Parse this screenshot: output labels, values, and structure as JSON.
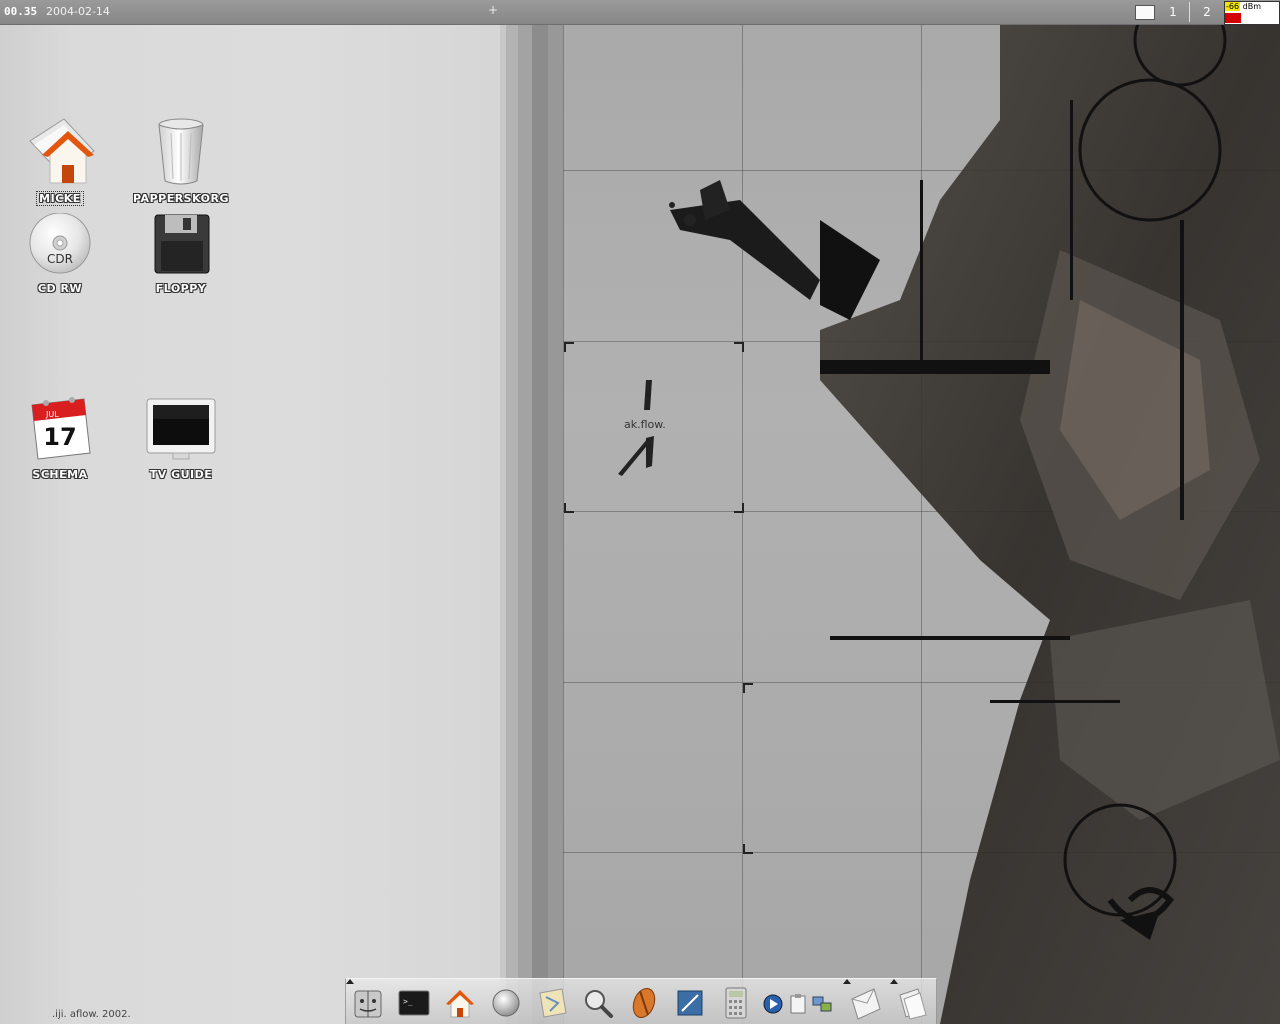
{
  "topbar": {
    "clock": "00.35",
    "date": "2004-02-14",
    "plus_label": "+",
    "workspaces": [
      "1",
      "2"
    ],
    "signal": {
      "value": "-66",
      "unit": "dBm",
      "level_fraction": 0.3
    }
  },
  "desktop": {
    "icons": [
      {
        "label": "MICKE",
        "icon": "home-folder-icon"
      },
      {
        "label": "PAPPERSKORG",
        "icon": "trash-icon"
      },
      {
        "label": "CD RW",
        "icon": "cd-icon",
        "disc_text": "CDR"
      },
      {
        "label": "FLOPPY",
        "icon": "floppy-icon"
      },
      {
        "label": "SCHEMA",
        "icon": "calendar-icon",
        "month": "JUL",
        "day": "17"
      },
      {
        "label": "TV GUIDE",
        "icon": "monitor-icon"
      }
    ],
    "credit": ".iji. aflow. 2002.",
    "wallpaper_text": "ak.flow."
  },
  "dock": {
    "items": [
      "finder-icon",
      "terminal-icon",
      "home-icon",
      "disc-icon",
      "map-icon",
      "magnifier-icon",
      "browser-icon",
      "editor-icon",
      "calculator-icon",
      "media-player-icon",
      "clipboard-icon",
      "network-icon",
      "mail-icon",
      "documents-icon"
    ]
  },
  "colors": {
    "topbar": "#8e8e8e",
    "signal_value_bg": "#f2e600",
    "signal_bar": "#d40000",
    "home_roof": "#e2560e"
  }
}
